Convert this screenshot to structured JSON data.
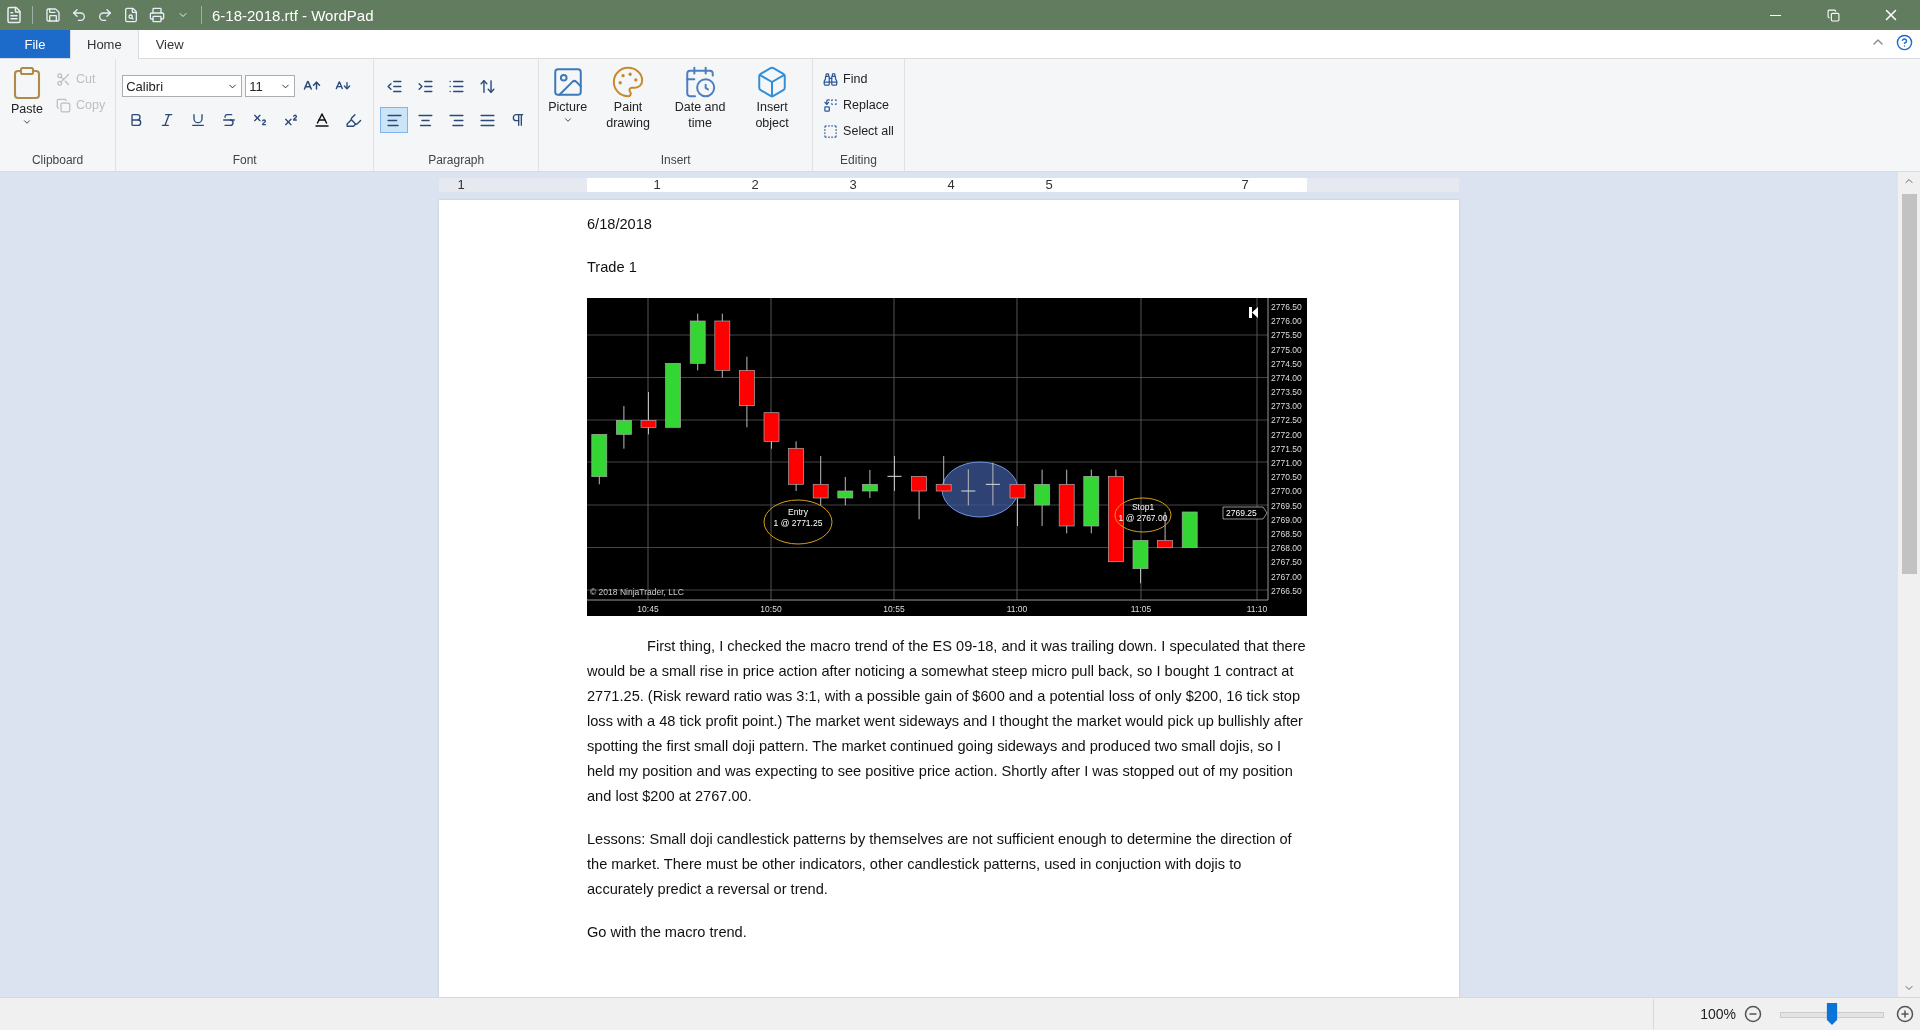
{
  "window": {
    "title": "6-18-2018.rtf - WordPad"
  },
  "tabs": [
    {
      "label": "File",
      "selected": false,
      "kind": "file"
    },
    {
      "label": "Home",
      "selected": true,
      "kind": "tab"
    },
    {
      "label": "View",
      "selected": false,
      "kind": "tab"
    }
  ],
  "ribbon": {
    "clipboard": {
      "label": "Clipboard",
      "paste": "Paste",
      "cut": {
        "label": "Cut",
        "disabled": true
      },
      "copy": {
        "label": "Copy",
        "disabled": true
      }
    },
    "font": {
      "label": "Font",
      "family": "Calibri",
      "size": "11"
    },
    "paragraph": {
      "label": "Paragraph",
      "alignment": [
        {
          "kind": "left",
          "selected": true
        },
        {
          "kind": "center",
          "selected": false
        },
        {
          "kind": "right",
          "selected": false
        },
        {
          "kind": "justify",
          "selected": false
        }
      ]
    },
    "insert": {
      "label": "Insert",
      "buttons": [
        {
          "kind": "picture",
          "label": "Picture"
        },
        {
          "kind": "paint",
          "label": "Paint drawing"
        },
        {
          "kind": "datetime",
          "label": "Date and time"
        },
        {
          "kind": "object",
          "label": "Insert object"
        }
      ]
    },
    "editing": {
      "label": "Editing",
      "buttons": [
        {
          "kind": "find",
          "label": "Find"
        },
        {
          "kind": "replace",
          "label": "Replace"
        },
        {
          "kind": "selectall",
          "label": "Select all"
        }
      ]
    }
  },
  "ruler": {
    "numbers": [
      "1",
      "1",
      "2",
      "3",
      "4",
      "5",
      "7"
    ]
  },
  "document": {
    "blocks": [
      {
        "kind": "line",
        "text": "6/18/2018"
      },
      {
        "kind": "line",
        "text": "Trade 1"
      },
      {
        "kind": "chart",
        "y_labels": [
          "2776.50",
          "2776.00",
          "2775.50",
          "2775.00",
          "2774.50",
          "2774.00",
          "2773.50",
          "2773.00",
          "2772.50",
          "2772.00",
          "2771.50",
          "2771.00",
          "2770.50",
          "2770.00",
          "2769.50",
          "2769.00",
          "2768.50",
          "2768.00",
          "2767.50",
          "2767.00",
          "2766.50"
        ],
        "x_labels": [
          "10:45",
          "10:50",
          "10:55",
          "11:00",
          "11:05",
          "11:10"
        ],
        "entry": [
          "Entry",
          "1 @ 2771.25"
        ],
        "stop": [
          "Stop1",
          "1 @ 2767.00"
        ],
        "price_marker": "2769.25",
        "copyright": "© 2018 NinjaTrader, LLC"
      },
      {
        "kind": "indented",
        "text": "First thing, I checked the macro trend of the ES 09-18, and it was trailing down. I speculated that there would be a small rise in price action after noticing a somewhat steep micro pull back, so I bought 1 contract at 2771.25. (Risk reward ratio was 3:1, with a possible gain of $600 and a potential loss of only $200, 16 tick stop loss with a 48 tick profit point.) The market went sideways and I thought the market would pick up bullishly after spotting the first small doji pattern. The market continued going sideways and produced two small dojis, so I held my position and was expecting to see positive price action. Shortly after I was stopped out of my position and lost $200 at 2767.00."
      },
      {
        "kind": "paragraph",
        "text": "Lessons:  Small doji candlestick patterns by themselves are not sufficient enough to determine the direction of the market. There must be other indicators, other candlestick patterns, used in conjuction with dojis to accurately predict  a reversal or trend."
      },
      {
        "kind": "line",
        "text": "Go with the macro trend."
      }
    ]
  },
  "status_bar": {
    "zoom": "100%",
    "level": 0.5
  }
}
